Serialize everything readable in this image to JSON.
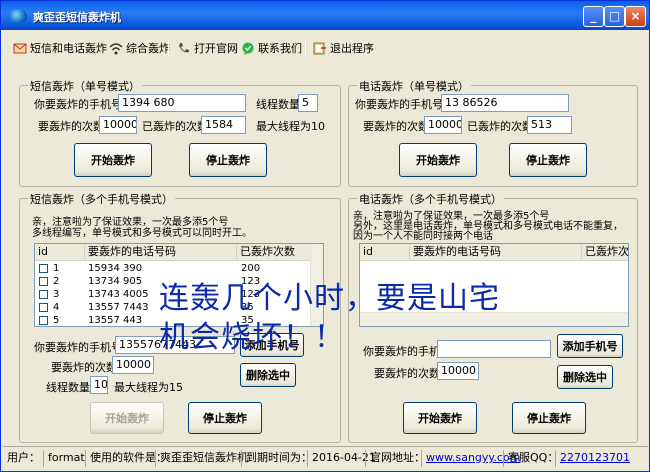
{
  "window": {
    "title": "爽歪歪短信轰炸机"
  },
  "menubar": {
    "items": [
      {
        "label": "短信和电话轰炸",
        "icon": "mail-icon"
      },
      {
        "label": "综合轰炸",
        "icon": "wifi-icon"
      },
      {
        "label": "打开官网",
        "icon": "phone-icon"
      },
      {
        "label": "联系我们",
        "icon": "chat-icon"
      },
      {
        "label": "退出程序",
        "icon": "exit-icon"
      }
    ]
  },
  "sms_single": {
    "title": "短信轰炸（单号模式）",
    "phone_label": "你要轰炸的手机号",
    "phone_value": "1394      680",
    "thread_label": "线程数量",
    "thread_value": "5",
    "times_label": "要轰炸的次数",
    "times_value": "10000",
    "done_label": "已轰炸的次数",
    "done_value": "1584",
    "max_thread": "最大线程为10",
    "start": "开始轰炸",
    "stop": "停止轰炸"
  },
  "call_single": {
    "title": "电话轰炸（单号模式）",
    "phone_label": "你要轰炸的手机号",
    "phone_value": "13      86526",
    "times_label": "要轰炸的次数",
    "times_value": "10000",
    "done_label": "已轰炸的次数",
    "done_value": "513",
    "start": "开始轰炸",
    "stop": "停止轰炸"
  },
  "sms_multi": {
    "title": "短信轰炸（多个手机号模式）",
    "notice_line1": "亲，注意啦为了保证效果，一次最多添5个号",
    "notice_line2": "多线程编写，单号模式和多号模式可以同时开工。",
    "columns": [
      "id",
      "要轰炸的电话号码",
      "已轰炸次数"
    ],
    "rows": [
      {
        "id": "1",
        "number": "15934     390",
        "count": "200"
      },
      {
        "id": "2",
        "number": "13734      905",
        "count": "123"
      },
      {
        "id": "3",
        "number": "13743      4005",
        "count": "123"
      },
      {
        "id": "4",
        "number": "13557      7443",
        "count": "35"
      },
      {
        "id": "5",
        "number": "13557      443",
        "count": "35"
      }
    ],
    "phone_label": "你要轰炸的手机号",
    "phone_value": "13557677443",
    "add_button": "添加手机号",
    "times_label": "要轰炸的次数",
    "times_value": "10000",
    "delete_button": "删除选中",
    "thread_label": "线程数量",
    "thread_value": "10",
    "max_thread": "最大线程为15",
    "start": "开始轰炸",
    "stop": "停止轰炸"
  },
  "call_multi": {
    "title": "电话轰炸（多个手机号模式）",
    "notice_line1": "亲，注意啦为了保证效果，一次最多添5个号",
    "notice_line2": "另外，这里是电话轰炸，单号模式和多号模式电话不能重复，",
    "notice_line3": "因为一个人不能同时接两个电话",
    "columns": [
      "id",
      "要轰炸的电话号码",
      "已轰炸次数"
    ],
    "phone_label": "你要轰炸的手机号",
    "phone_value": "",
    "add_button": "添加手机号",
    "times_label": "要轰炸的次数",
    "times_value": "10000",
    "delete_button": "删除选中",
    "start": "开始轰炸",
    "stop": "停止轰炸"
  },
  "overlay": {
    "line1": "连轰几个小时，要是山宅",
    "line2": "机会烧坏！！"
  },
  "statusbar": {
    "user_label": "用户：",
    "user_value": "format",
    "software_label": "使用的软件是：",
    "software_value": "爽歪歪短信轰炸机",
    "expire_label": "到期时间为：",
    "expire_value": "2016-04-21",
    "site_label": "官网地址：",
    "site_value": "www.sangyy.com",
    "qq_label": "客服QQ：",
    "qq_value": "2270123701"
  }
}
